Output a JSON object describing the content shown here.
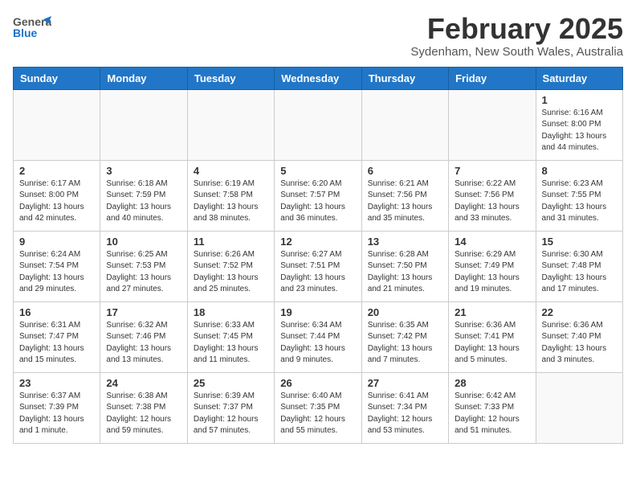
{
  "header": {
    "logo_general": "General",
    "logo_blue": "Blue",
    "title": "February 2025",
    "subtitle": "Sydenham, New South Wales, Australia"
  },
  "weekdays": [
    "Sunday",
    "Monday",
    "Tuesday",
    "Wednesday",
    "Thursday",
    "Friday",
    "Saturday"
  ],
  "weeks": [
    [
      {
        "day": "",
        "info": ""
      },
      {
        "day": "",
        "info": ""
      },
      {
        "day": "",
        "info": ""
      },
      {
        "day": "",
        "info": ""
      },
      {
        "day": "",
        "info": ""
      },
      {
        "day": "",
        "info": ""
      },
      {
        "day": "1",
        "info": "Sunrise: 6:16 AM\nSunset: 8:00 PM\nDaylight: 13 hours\nand 44 minutes."
      }
    ],
    [
      {
        "day": "2",
        "info": "Sunrise: 6:17 AM\nSunset: 8:00 PM\nDaylight: 13 hours\nand 42 minutes."
      },
      {
        "day": "3",
        "info": "Sunrise: 6:18 AM\nSunset: 7:59 PM\nDaylight: 13 hours\nand 40 minutes."
      },
      {
        "day": "4",
        "info": "Sunrise: 6:19 AM\nSunset: 7:58 PM\nDaylight: 13 hours\nand 38 minutes."
      },
      {
        "day": "5",
        "info": "Sunrise: 6:20 AM\nSunset: 7:57 PM\nDaylight: 13 hours\nand 36 minutes."
      },
      {
        "day": "6",
        "info": "Sunrise: 6:21 AM\nSunset: 7:56 PM\nDaylight: 13 hours\nand 35 minutes."
      },
      {
        "day": "7",
        "info": "Sunrise: 6:22 AM\nSunset: 7:56 PM\nDaylight: 13 hours\nand 33 minutes."
      },
      {
        "day": "8",
        "info": "Sunrise: 6:23 AM\nSunset: 7:55 PM\nDaylight: 13 hours\nand 31 minutes."
      }
    ],
    [
      {
        "day": "9",
        "info": "Sunrise: 6:24 AM\nSunset: 7:54 PM\nDaylight: 13 hours\nand 29 minutes."
      },
      {
        "day": "10",
        "info": "Sunrise: 6:25 AM\nSunset: 7:53 PM\nDaylight: 13 hours\nand 27 minutes."
      },
      {
        "day": "11",
        "info": "Sunrise: 6:26 AM\nSunset: 7:52 PM\nDaylight: 13 hours\nand 25 minutes."
      },
      {
        "day": "12",
        "info": "Sunrise: 6:27 AM\nSunset: 7:51 PM\nDaylight: 13 hours\nand 23 minutes."
      },
      {
        "day": "13",
        "info": "Sunrise: 6:28 AM\nSunset: 7:50 PM\nDaylight: 13 hours\nand 21 minutes."
      },
      {
        "day": "14",
        "info": "Sunrise: 6:29 AM\nSunset: 7:49 PM\nDaylight: 13 hours\nand 19 minutes."
      },
      {
        "day": "15",
        "info": "Sunrise: 6:30 AM\nSunset: 7:48 PM\nDaylight: 13 hours\nand 17 minutes."
      }
    ],
    [
      {
        "day": "16",
        "info": "Sunrise: 6:31 AM\nSunset: 7:47 PM\nDaylight: 13 hours\nand 15 minutes."
      },
      {
        "day": "17",
        "info": "Sunrise: 6:32 AM\nSunset: 7:46 PM\nDaylight: 13 hours\nand 13 minutes."
      },
      {
        "day": "18",
        "info": "Sunrise: 6:33 AM\nSunset: 7:45 PM\nDaylight: 13 hours\nand 11 minutes."
      },
      {
        "day": "19",
        "info": "Sunrise: 6:34 AM\nSunset: 7:44 PM\nDaylight: 13 hours\nand 9 minutes."
      },
      {
        "day": "20",
        "info": "Sunrise: 6:35 AM\nSunset: 7:42 PM\nDaylight: 13 hours\nand 7 minutes."
      },
      {
        "day": "21",
        "info": "Sunrise: 6:36 AM\nSunset: 7:41 PM\nDaylight: 13 hours\nand 5 minutes."
      },
      {
        "day": "22",
        "info": "Sunrise: 6:36 AM\nSunset: 7:40 PM\nDaylight: 13 hours\nand 3 minutes."
      }
    ],
    [
      {
        "day": "23",
        "info": "Sunrise: 6:37 AM\nSunset: 7:39 PM\nDaylight: 13 hours\nand 1 minute."
      },
      {
        "day": "24",
        "info": "Sunrise: 6:38 AM\nSunset: 7:38 PM\nDaylight: 12 hours\nand 59 minutes."
      },
      {
        "day": "25",
        "info": "Sunrise: 6:39 AM\nSunset: 7:37 PM\nDaylight: 12 hours\nand 57 minutes."
      },
      {
        "day": "26",
        "info": "Sunrise: 6:40 AM\nSunset: 7:35 PM\nDaylight: 12 hours\nand 55 minutes."
      },
      {
        "day": "27",
        "info": "Sunrise: 6:41 AM\nSunset: 7:34 PM\nDaylight: 12 hours\nand 53 minutes."
      },
      {
        "day": "28",
        "info": "Sunrise: 6:42 AM\nSunset: 7:33 PM\nDaylight: 12 hours\nand 51 minutes."
      },
      {
        "day": "",
        "info": ""
      }
    ]
  ]
}
